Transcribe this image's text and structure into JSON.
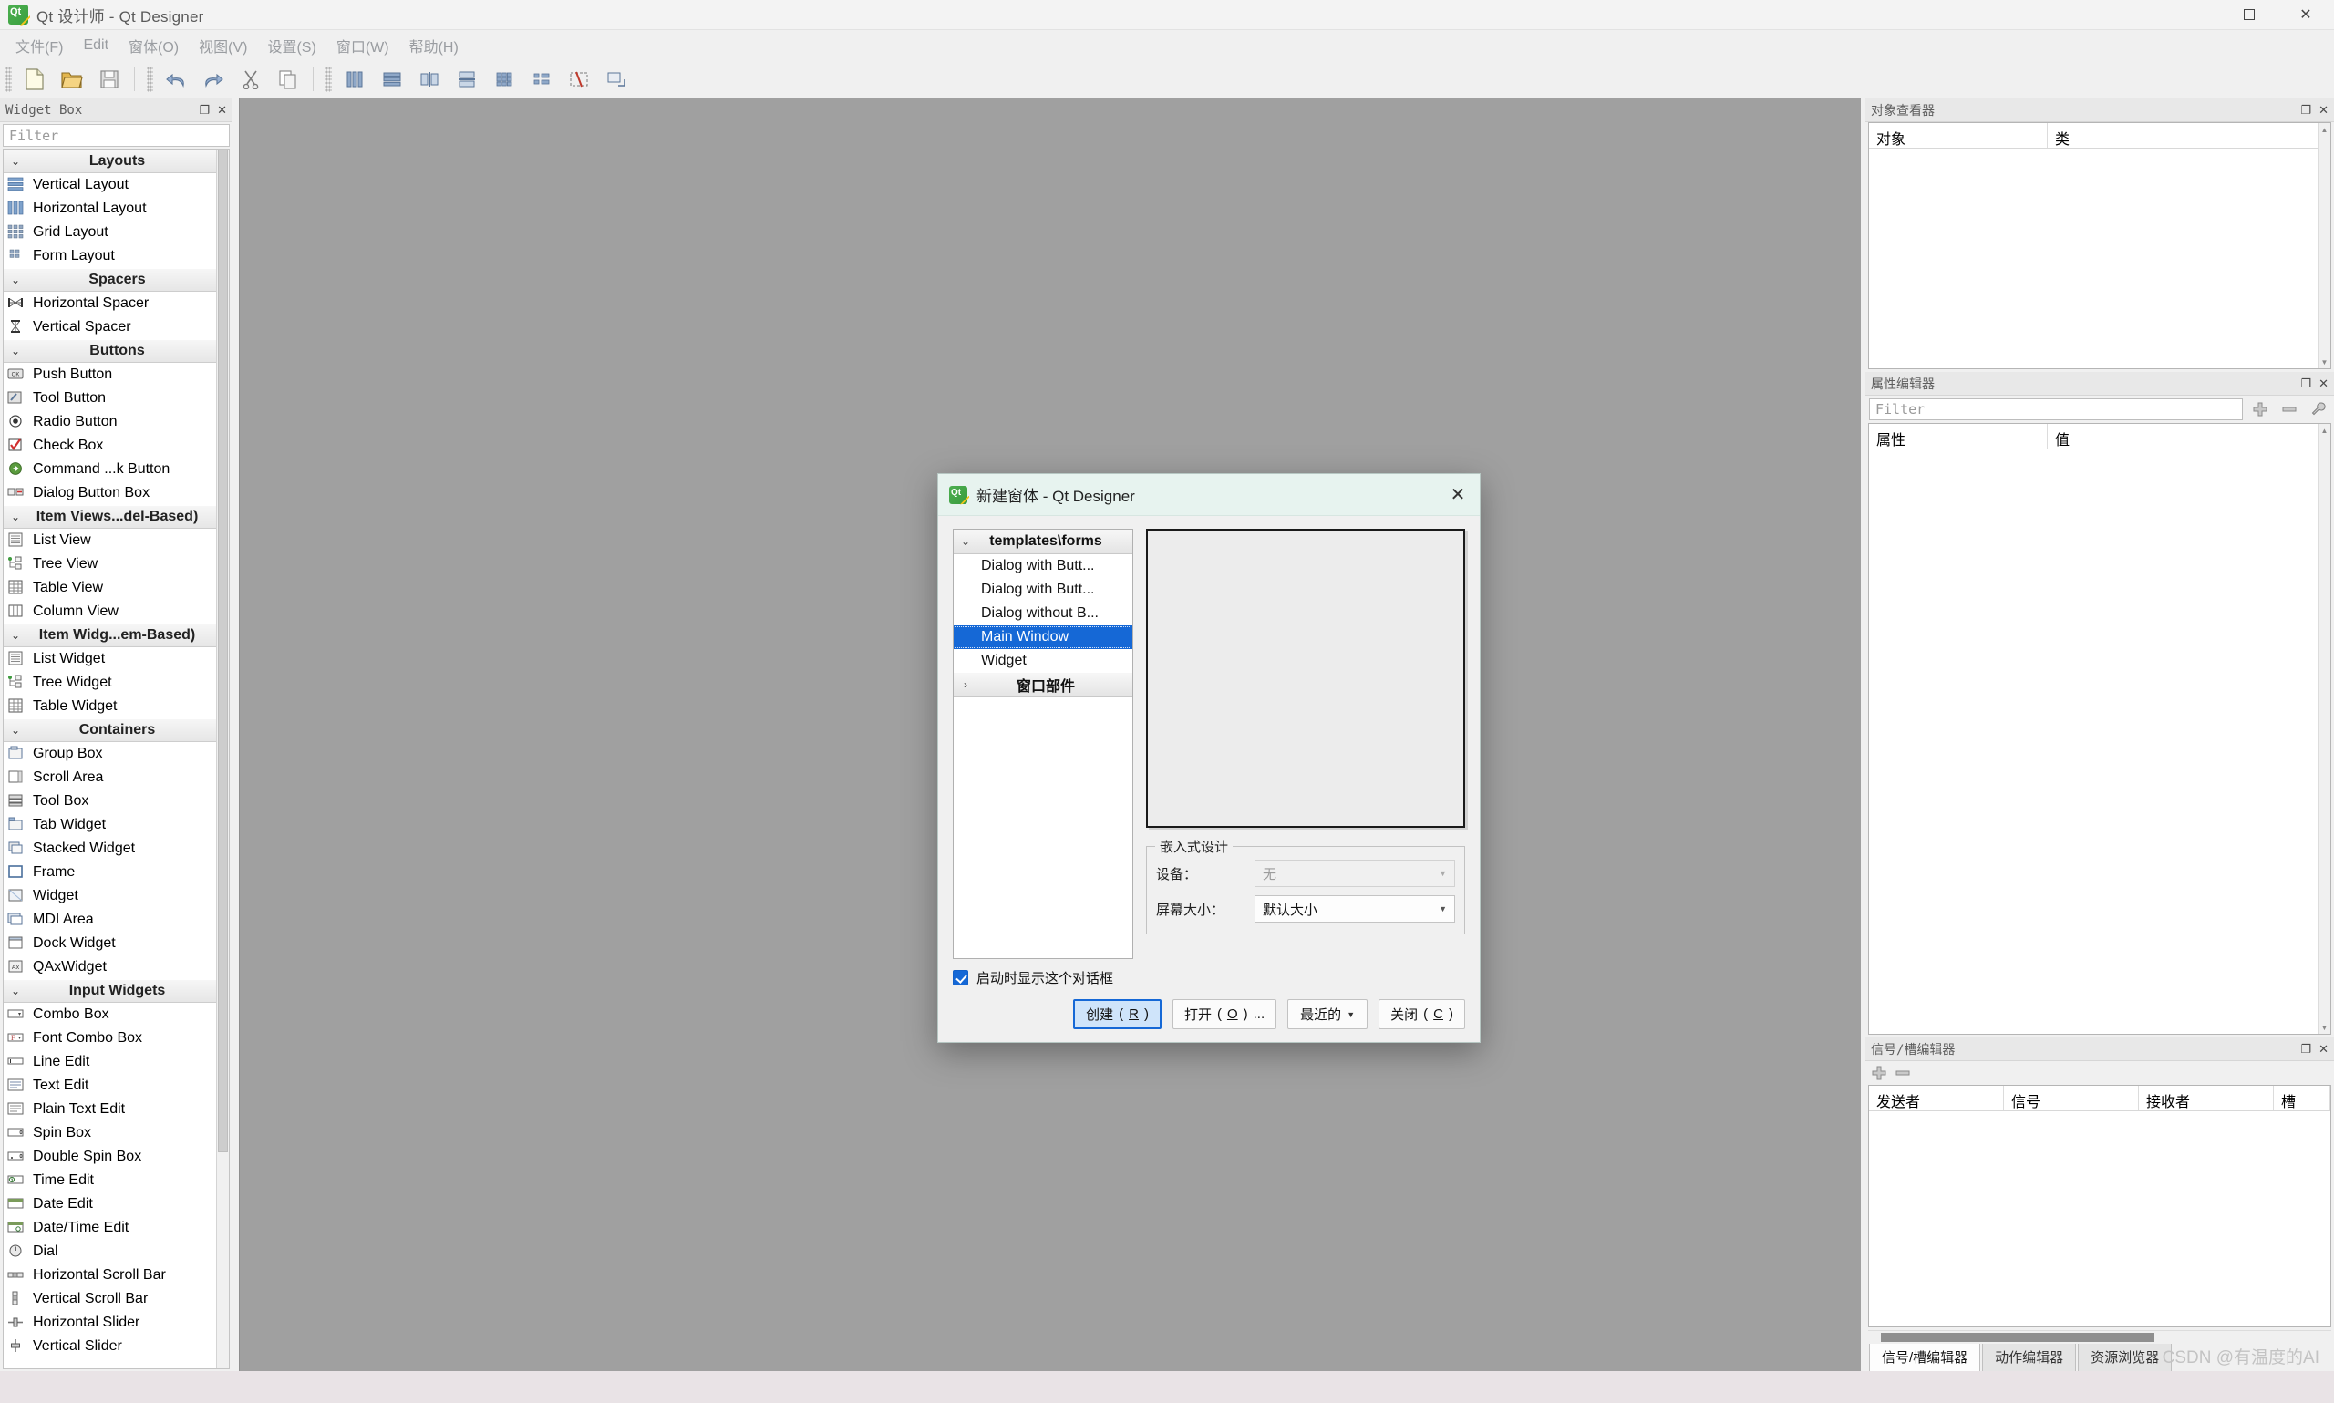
{
  "window": {
    "title": "Qt 设计师 - Qt Designer",
    "app_icon": "qt-designer-icon",
    "minimize_label": "minimize-icon",
    "maximize_label": "maximize-icon",
    "close_label": "close-icon"
  },
  "menubar": {
    "items": [
      {
        "label": "文件(F)"
      },
      {
        "label": "Edit"
      },
      {
        "label": "窗体(O)"
      },
      {
        "label": "视图(V)"
      },
      {
        "label": "设置(S)"
      },
      {
        "label": "窗口(W)"
      },
      {
        "label": "帮助(H)"
      }
    ]
  },
  "toolbar": {
    "groups": [
      {
        "buttons": [
          {
            "name": "new-form-button",
            "icon": "new-file-icon"
          },
          {
            "name": "open-form-button",
            "icon": "open-folder-icon"
          },
          {
            "name": "save-form-button",
            "icon": "save-disk-icon"
          }
        ]
      },
      {
        "buttons": [
          {
            "name": "undo-button",
            "icon": "undo-arrow-icon"
          },
          {
            "name": "redo-button",
            "icon": "redo-arrow-icon"
          },
          {
            "name": "cut-button",
            "icon": "scissors-icon"
          },
          {
            "name": "copy-button",
            "icon": "copy-icon"
          }
        ]
      },
      {
        "buttons": [
          {
            "name": "layout-vertical-button",
            "icon": "layout-vertical-icon"
          },
          {
            "name": "layout-horizontal-button",
            "icon": "layout-horizontal-icon"
          },
          {
            "name": "layout-splitter-h-button",
            "icon": "splitter-horizontal-icon"
          },
          {
            "name": "layout-splitter-v-button",
            "icon": "splitter-vertical-icon"
          },
          {
            "name": "layout-grid-button",
            "icon": "grid-layout-icon"
          },
          {
            "name": "layout-form-button",
            "icon": "form-layout-icon"
          },
          {
            "name": "break-layout-button",
            "icon": "break-layout-icon"
          },
          {
            "name": "adjust-size-button",
            "icon": "adjust-size-icon"
          }
        ]
      }
    ]
  },
  "widget_box": {
    "panel_title": "Widget Box",
    "float_icon": "float-panel-icon",
    "close_icon": "close-panel-icon",
    "filter_placeholder": "Filter",
    "categories": [
      {
        "label": "Layouts",
        "expanded": true,
        "items": [
          {
            "label": "Vertical Layout",
            "icon": "vertical-layout-icon"
          },
          {
            "label": "Horizontal Layout",
            "icon": "horizontal-layout-icon"
          },
          {
            "label": "Grid Layout",
            "icon": "grid-layout-icon"
          },
          {
            "label": "Form Layout",
            "icon": "form-layout-icon"
          }
        ]
      },
      {
        "label": "Spacers",
        "expanded": true,
        "items": [
          {
            "label": "Horizontal Spacer",
            "icon": "horizontal-spacer-icon"
          },
          {
            "label": "Vertical Spacer",
            "icon": "vertical-spacer-icon"
          }
        ]
      },
      {
        "label": "Buttons",
        "expanded": true,
        "items": [
          {
            "label": "Push Button",
            "icon": "push-button-icon"
          },
          {
            "label": "Tool Button",
            "icon": "tool-button-icon"
          },
          {
            "label": "Radio Button",
            "icon": "radio-button-icon"
          },
          {
            "label": "Check Box",
            "icon": "check-box-icon"
          },
          {
            "label": "Command ...k Button",
            "icon": "command-link-icon"
          },
          {
            "label": "Dialog Button Box",
            "icon": "dialog-button-box-icon"
          }
        ]
      },
      {
        "label": "Item Views...del-Based)",
        "expanded": true,
        "items": [
          {
            "label": "List View",
            "icon": "list-view-icon"
          },
          {
            "label": "Tree View",
            "icon": "tree-view-icon"
          },
          {
            "label": "Table View",
            "icon": "table-view-icon"
          },
          {
            "label": "Column View",
            "icon": "column-view-icon"
          }
        ]
      },
      {
        "label": "Item Widg...em-Based)",
        "expanded": true,
        "items": [
          {
            "label": "List Widget",
            "icon": "list-widget-icon"
          },
          {
            "label": "Tree Widget",
            "icon": "tree-widget-icon"
          },
          {
            "label": "Table Widget",
            "icon": "table-widget-icon"
          }
        ]
      },
      {
        "label": "Containers",
        "expanded": true,
        "items": [
          {
            "label": "Group Box",
            "icon": "group-box-icon"
          },
          {
            "label": "Scroll Area",
            "icon": "scroll-area-icon"
          },
          {
            "label": "Tool Box",
            "icon": "tool-box-icon"
          },
          {
            "label": "Tab Widget",
            "icon": "tab-widget-icon"
          },
          {
            "label": "Stacked Widget",
            "icon": "stacked-widget-icon"
          },
          {
            "label": "Frame",
            "icon": "frame-icon"
          },
          {
            "label": "Widget",
            "icon": "widget-icon"
          },
          {
            "label": "MDI Area",
            "icon": "mdi-area-icon"
          },
          {
            "label": "Dock Widget",
            "icon": "dock-widget-icon"
          },
          {
            "label": "QAxWidget",
            "icon": "qax-widget-icon"
          }
        ]
      },
      {
        "label": "Input Widgets",
        "expanded": true,
        "items": [
          {
            "label": "Combo Box",
            "icon": "combo-box-icon"
          },
          {
            "label": "Font Combo Box",
            "icon": "font-combo-box-icon"
          },
          {
            "label": "Line Edit",
            "icon": "line-edit-icon"
          },
          {
            "label": "Text Edit",
            "icon": "text-edit-icon"
          },
          {
            "label": "Plain Text Edit",
            "icon": "plain-text-edit-icon"
          },
          {
            "label": "Spin Box",
            "icon": "spin-box-icon"
          },
          {
            "label": "Double Spin Box",
            "icon": "double-spin-box-icon"
          },
          {
            "label": "Time Edit",
            "icon": "time-edit-icon"
          },
          {
            "label": "Date Edit",
            "icon": "date-edit-icon"
          },
          {
            "label": "Date/Time Edit",
            "icon": "date-time-edit-icon"
          },
          {
            "label": "Dial",
            "icon": "dial-icon"
          },
          {
            "label": "Horizontal Scroll Bar",
            "icon": "horizontal-scroll-bar-icon"
          },
          {
            "label": "Vertical Scroll Bar",
            "icon": "vertical-scroll-bar-icon"
          },
          {
            "label": "Horizontal Slider",
            "icon": "horizontal-slider-icon"
          },
          {
            "label": "Vertical Slider",
            "icon": "vertical-slider-icon"
          }
        ]
      }
    ]
  },
  "object_inspector": {
    "panel_title": "对象查看器",
    "float_icon": "float-panel-icon",
    "close_icon": "close-panel-icon",
    "columns": [
      "对象",
      "类"
    ],
    "rows": []
  },
  "property_editor": {
    "panel_title": "属性编辑器",
    "float_icon": "float-panel-icon",
    "close_icon": "close-panel-icon",
    "filter_placeholder": "Filter",
    "add_icon": "plus-icon",
    "remove_icon": "minus-icon",
    "configure_icon": "wrench-icon",
    "columns": [
      "属性",
      "值"
    ],
    "rows": []
  },
  "signal_slot_editor": {
    "panel_title": "信号/槽编辑器",
    "float_icon": "float-panel-icon",
    "close_icon": "close-panel-icon",
    "add_icon": "plus-icon",
    "remove_icon": "minus-icon",
    "columns": [
      "发送者",
      "信号",
      "接收者",
      "槽"
    ],
    "rows": [],
    "tabs": [
      {
        "label": "信号/槽编辑器",
        "active": true
      },
      {
        "label": "动作编辑器",
        "active": false
      },
      {
        "label": "资源浏览器",
        "active": false
      }
    ]
  },
  "dialog": {
    "title": "新建窗体 - Qt Designer",
    "icon": "qt-designer-icon",
    "close_icon": "close-icon",
    "templates": {
      "category": "templates\\forms",
      "category_expanded": true,
      "items": [
        {
          "label": "Dialog with Butt...",
          "selected": false
        },
        {
          "label": "Dialog with Butt...",
          "selected": false
        },
        {
          "label": "Dialog without B...",
          "selected": false
        },
        {
          "label": "Main Window",
          "selected": true
        },
        {
          "label": "Widget",
          "selected": false
        }
      ],
      "second_category": "窗口部件",
      "second_category_expanded": false
    },
    "embedded": {
      "group_title": "嵌入式设计",
      "device_label": "设备：",
      "device_value": "无",
      "device_disabled": true,
      "screen_size_label": "屏幕大小：",
      "screen_size_value": "默认大小"
    },
    "show_on_startup": {
      "label": "启动时显示这个对话框",
      "checked": true
    },
    "buttons": {
      "create": {
        "label": "创建",
        "accel": "R",
        "default": true
      },
      "open": {
        "label": "打开",
        "accel": "O",
        "suffix": "..."
      },
      "recent": {
        "label": "最近的",
        "has_menu": true
      },
      "close": {
        "label": "关闭",
        "accel": "C"
      }
    }
  },
  "watermark": "CSDN @有温度的AI",
  "colors": {
    "selection_blue": "#1568d6",
    "canvas_gray": "#a0a0a0",
    "dialog_title_bg": "#e7f3ef",
    "panel_bg": "#f0f0f0",
    "statusbar_bg": "#e9e3e6"
  }
}
